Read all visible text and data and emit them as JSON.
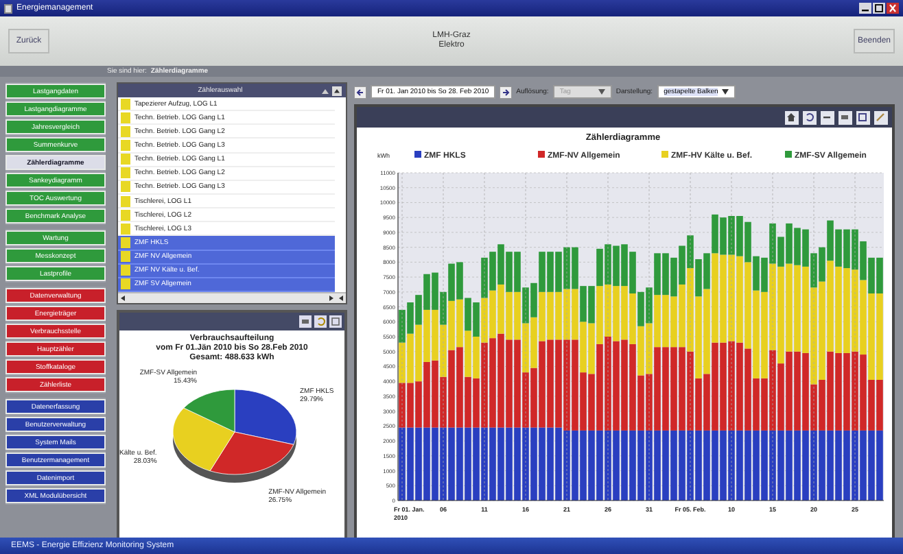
{
  "window": {
    "title": "Energiemanagement"
  },
  "header": {
    "back_button": "Zurück",
    "location": [
      "LMH-Graz",
      "Elektro"
    ],
    "exit_button": "Beenden"
  },
  "breadcrumb": {
    "label": "Sie sind hier:",
    "page": "Zählerdiagramme"
  },
  "sidebar": {
    "groups": [
      {
        "color": "#2f9a3c",
        "items": [
          {
            "label": "Lastgangdaten",
            "selected": false
          },
          {
            "label": "Lastgangdiagramme",
            "selected": false
          },
          {
            "label": "Jahresvergleich",
            "selected": false
          },
          {
            "label": "Summenkurve",
            "selected": false
          },
          {
            "label": "Zählerdiagramme",
            "selected": true
          },
          {
            "label": "Sankeydiagramm",
            "selected": false
          },
          {
            "label": "TOC Auswertung",
            "selected": false
          },
          {
            "label": "Benchmark Analyse",
            "selected": false
          }
        ]
      },
      {
        "color": "#2f9a3c",
        "items": [
          {
            "label": "Wartung",
            "selected": false
          },
          {
            "label": "Messkonzept",
            "selected": false
          },
          {
            "label": "Lastprofile",
            "selected": false
          }
        ]
      },
      {
        "color": "#c8202a",
        "items": [
          {
            "label": "Datenverwaltung",
            "selected": false
          },
          {
            "label": "Energieträger",
            "selected": false
          },
          {
            "label": "Verbrauchsstelle",
            "selected": false
          },
          {
            "label": "Hauptzähler",
            "selected": false
          },
          {
            "label": "Stoffkataloge",
            "selected": false
          },
          {
            "label": "Zählerliste",
            "selected": false
          }
        ]
      },
      {
        "color": "#2a3fa8",
        "items": [
          {
            "label": "Datenerfassung",
            "selected": false
          },
          {
            "label": "Benutzerverwaltung",
            "selected": false
          },
          {
            "label": "System Mails",
            "selected": false
          },
          {
            "label": "Benutzermanagement",
            "selected": false
          },
          {
            "label": "Datenimport",
            "selected": false
          },
          {
            "label": "XML Modulübersicht",
            "selected": false
          }
        ]
      }
    ]
  },
  "meter_list": {
    "title": "Zählerauswahl",
    "items": [
      {
        "label": "Tapezierer Aufzug, LOG L1",
        "selected": false
      },
      {
        "label": "Techn. Betrieb. LOG Gang L1",
        "selected": false
      },
      {
        "label": "Techn. Betrieb. LOG Gang L2",
        "selected": false
      },
      {
        "label": "Techn. Betrieb. LOG Gang L3",
        "selected": false
      },
      {
        "label": "Techn. Betrieb. LOG Gang L1",
        "selected": false
      },
      {
        "label": "Techn. Betrieb. LOG Gang L2",
        "selected": false
      },
      {
        "label": "Techn. Betrieb. LOG Gang L3",
        "selected": false
      },
      {
        "label": "Tischlerei, LOG L1",
        "selected": false
      },
      {
        "label": "Tischlerei, LOG L2",
        "selected": false
      },
      {
        "label": "Tischlerei, LOG L3",
        "selected": false
      },
      {
        "label": "ZMF HKLS",
        "selected": true
      },
      {
        "label": "ZMF NV Allgemein",
        "selected": true
      },
      {
        "label": "ZMF NV Kälte u. Bef.",
        "selected": true
      },
      {
        "label": "ZMF SV Allgemein",
        "selected": true
      }
    ]
  },
  "pie_panel": {
    "title_lines": [
      "Verbrauchsaufteilung",
      "vom Fr 01.Jän 2010 bis So 28.Feb 2010",
      "Gesamt: 488.633 kWh"
    ],
    "chart_data": {
      "type": "pie",
      "categories": [
        "ZMF HKLS",
        "ZMF-NV Allgemein",
        "Kälte u. Bef.",
        "ZMF-SV Allgemein"
      ],
      "series": [
        {
          "values": [
            29.79,
            26.75,
            28.03,
            15.43
          ]
        }
      ],
      "colors": [
        "#2a3fc0",
        "#d02828",
        "#e8d020",
        "#2f9a3c"
      ],
      "value_labels": [
        "29.79%",
        "26.75%",
        "28.03%",
        "15.43%"
      ]
    }
  },
  "toolbar": {
    "date_range": "Fr 01. Jan 2010 bis So 28. Feb 2010",
    "resolution_label": "Auflösung:",
    "resolution": "Tag",
    "resolution_disabled": true,
    "display_label": "Darstellung:",
    "display": "gestapelte Balken"
  },
  "chart_panel": {
    "x_axis_labels": [
      "Fr 01. Jan. 2010",
      "06",
      "11",
      "16",
      "21",
      "26",
      "31",
      "Fr 05. Feb.",
      "10",
      "15",
      "20",
      "25"
    ],
    "chart_data": {
      "type": "bar",
      "stacked": true,
      "grid": true,
      "legend": true,
      "title": "Zählerdiagramme",
      "ylabel": "kWh",
      "ylim": [
        0,
        11000
      ],
      "yticks": [
        0,
        500,
        1000,
        1500,
        2000,
        2500,
        3000,
        3500,
        4000,
        4500,
        5000,
        5500,
        6000,
        6500,
        7000,
        7500,
        8000,
        8500,
        9000,
        9500,
        10000,
        10500,
        11000
      ],
      "series": [
        {
          "name": "ZMF HKLS",
          "color": "#2a3fc0",
          "values": [
            2450,
            2450,
            2450,
            2450,
            2450,
            2450,
            2450,
            2450,
            2450,
            2450,
            2450,
            2450,
            2450,
            2450,
            2450,
            2450,
            2450,
            2450,
            2450,
            2450,
            2350,
            2350,
            2350,
            2350,
            2350,
            2350,
            2350,
            2350,
            2350,
            2350,
            2350,
            2350,
            2350,
            2350,
            2350,
            2350,
            2350,
            2350,
            2350,
            2350,
            2350,
            2350,
            2350,
            2350,
            2350,
            2350,
            2350,
            2350,
            2350,
            2350,
            2350,
            2350,
            2350,
            2350,
            2350,
            2350,
            2350,
            2350,
            2350
          ]
        },
        {
          "name": "ZMF-NV Allgemein",
          "color": "#d02828",
          "values": [
            1500,
            1500,
            1550,
            2200,
            2250,
            1700,
            2600,
            2700,
            1700,
            1650,
            2850,
            3000,
            3150,
            2950,
            2950,
            1850,
            2000,
            2900,
            2950,
            2950,
            3050,
            3050,
            1950,
            1900,
            2900,
            3150,
            3000,
            3050,
            2900,
            1850,
            1900,
            2800,
            2800,
            2800,
            2800,
            2650,
            1750,
            1900,
            2950,
            2950,
            3000,
            2950,
            2750,
            1750,
            1750,
            2700,
            2250,
            2650,
            2650,
            2600,
            1550,
            1700,
            2650,
            2600,
            2600,
            2650,
            2550,
            1700,
            1700
          ]
        },
        {
          "name": "ZMF-HV Kälte u. Bef.",
          "color": "#e8d020",
          "values": [
            1350,
            1650,
            1900,
            1750,
            1700,
            1750,
            1650,
            1600,
            1550,
            1400,
            1500,
            1600,
            1650,
            1600,
            1600,
            1650,
            1700,
            1650,
            1600,
            1600,
            1700,
            1700,
            1700,
            1700,
            1950,
            1750,
            1850,
            1800,
            1700,
            1650,
            1700,
            1750,
            1750,
            1700,
            2100,
            2800,
            2750,
            2850,
            3000,
            2950,
            2900,
            2900,
            2900,
            2950,
            2900,
            2900,
            3250,
            2950,
            2900,
            2900,
            3250,
            3300,
            3050,
            2900,
            2850,
            2750,
            2500,
            2900,
            2900
          ]
        },
        {
          "name": "ZMF-SV Allgemein",
          "color": "#2f9a3c",
          "values": [
            1100,
            1050,
            1000,
            1200,
            1250,
            1100,
            1250,
            1250,
            1100,
            1150,
            1350,
            1300,
            1350,
            1350,
            1350,
            1200,
            1150,
            1350,
            1350,
            1350,
            1400,
            1400,
            1200,
            1250,
            1250,
            1350,
            1350,
            1400,
            1400,
            1150,
            1200,
            1400,
            1400,
            1300,
            1300,
            1100,
            1250,
            1200,
            1300,
            1250,
            1300,
            1350,
            1350,
            1150,
            1150,
            1350,
            1000,
            1350,
            1250,
            1250,
            1150,
            1150,
            1350,
            1250,
            1300,
            1350,
            1300,
            1200,
            1200
          ]
        }
      ]
    }
  },
  "status_bar": {
    "text": "EEMS - Energie Effizienz Monitoring System"
  }
}
